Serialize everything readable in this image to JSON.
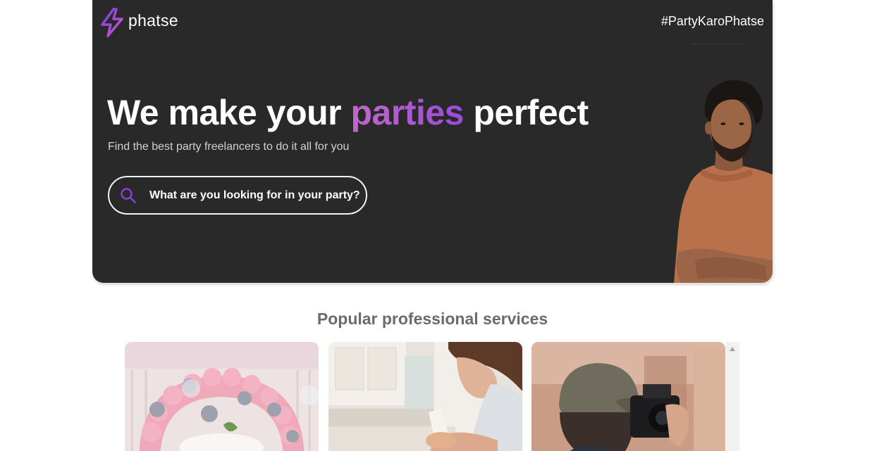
{
  "brand": {
    "name": "phatse",
    "tagline": "#PartyKaroPhatse",
    "accent_color": "#9a4ad8"
  },
  "hero": {
    "headline_prefix": "We make your ",
    "headline_accent": "parties",
    "headline_suffix": " perfect",
    "subheadline": "Find the best party freelancers to do it all for you",
    "search_text": "What are you looking for in your party?",
    "background_color": "#292929"
  },
  "services": {
    "title": "Popular professional services",
    "cards": [
      {
        "image": "balloon-arch-decoration"
      },
      {
        "image": "woman-baking-cake"
      },
      {
        "image": "photographer-with-camera"
      }
    ]
  }
}
